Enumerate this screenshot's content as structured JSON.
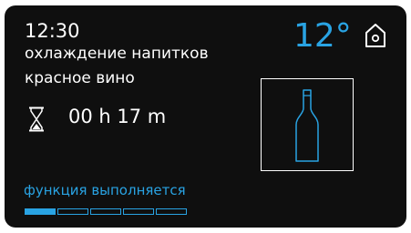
{
  "accent_color": "#29a3e3",
  "clock": {
    "time": "12:30"
  },
  "program": {
    "mode_label": "охлаждение напитков",
    "drink_label": "красное вино"
  },
  "temperature": {
    "value": "12°"
  },
  "timer": {
    "icon": "hourglass-icon",
    "remaining": "00 h 17 m"
  },
  "drink_illustration": {
    "icon": "wine-bottle-icon"
  },
  "home_button": {
    "icon": "home-icon"
  },
  "status": {
    "text": "функция выполняется",
    "progress": {
      "total_segments": 5,
      "filled_segments": 1
    }
  }
}
